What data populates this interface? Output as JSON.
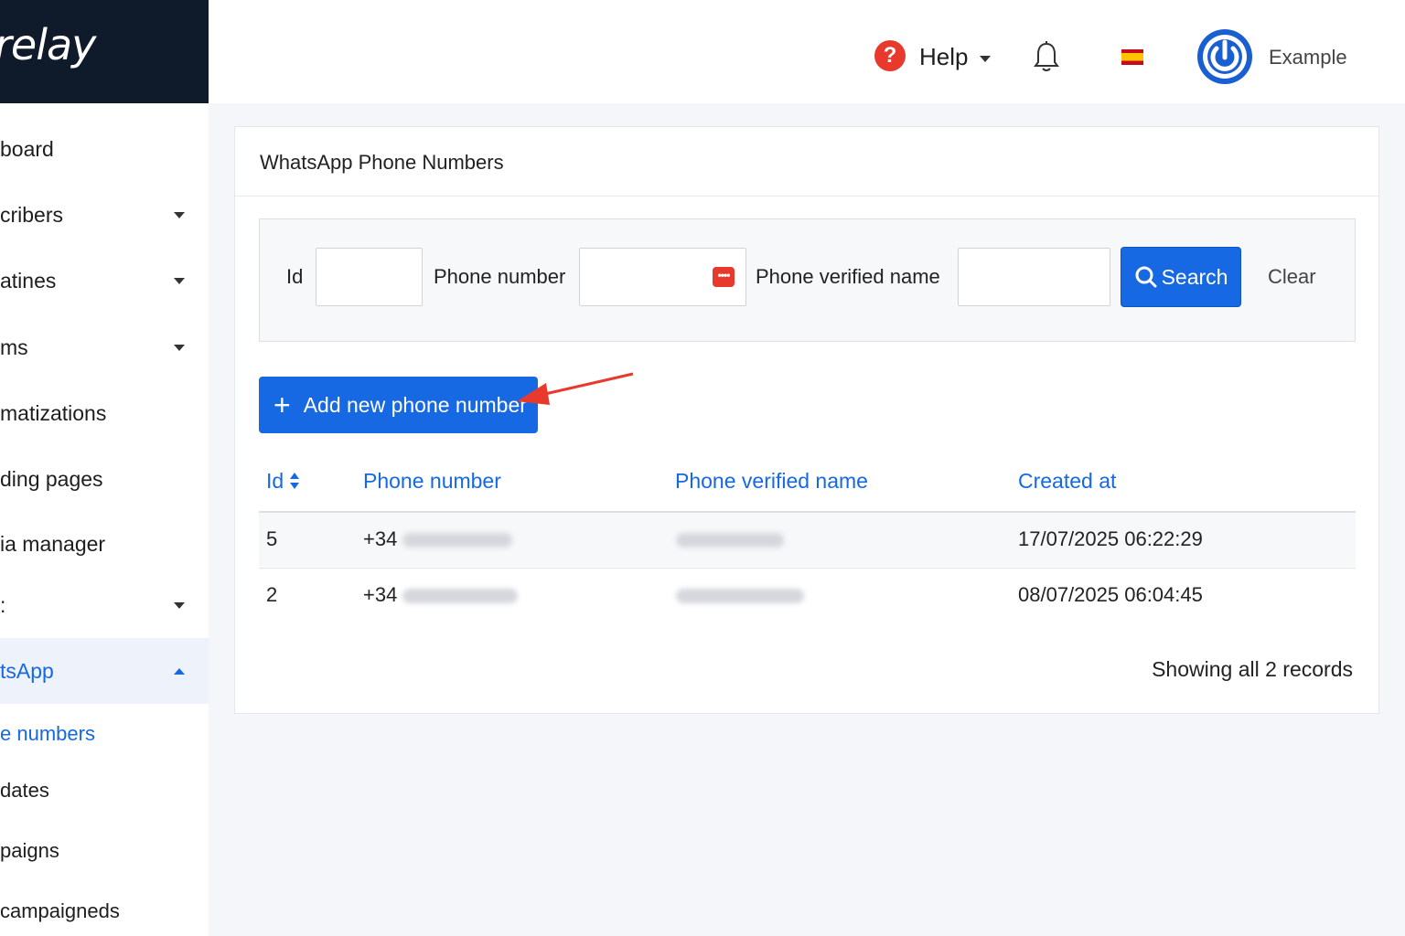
{
  "brand": {
    "logo_text": "relay"
  },
  "sidebar": {
    "items": [
      {
        "label": "board",
        "caret": false
      },
      {
        "label": "cribers",
        "caret": true
      },
      {
        "label": "atines",
        "caret": true
      },
      {
        "label": "ms",
        "caret": true
      },
      {
        "label": " matizations",
        "caret": false
      },
      {
        "label": "ding pages",
        "caret": false
      },
      {
        "label": "ia manager",
        "caret": false
      },
      {
        "label": ":",
        "caret": true
      },
      {
        "label": "tsApp",
        "caret": true,
        "active": true
      }
    ],
    "subitems": [
      {
        "label": "e numbers",
        "current": true
      },
      {
        "label": "dates"
      },
      {
        "label": "paigns"
      },
      {
        "label": " campaigneds"
      }
    ]
  },
  "header": {
    "help_label": "Help",
    "user_name": "Example",
    "icons": [
      "help-icon",
      "bell-icon",
      "spain-flag-icon",
      "power-icon"
    ]
  },
  "card": {
    "title": "WhatsApp Phone Numbers",
    "filter": {
      "id_label": "Id",
      "id_value": "",
      "phone_label": "Phone number",
      "phone_value": "",
      "verified_label": "Phone verified name",
      "verified_value": "",
      "search_label": "Search",
      "clear_label": "Clear"
    },
    "add_button_label": "Add new phone number",
    "table": {
      "headers": [
        "Id",
        "Phone number",
        "Phone verified name",
        "Created at"
      ],
      "rows": [
        {
          "id": "5",
          "phone_prefix": "+34",
          "created_at": "17/07/2025 06:22:29"
        },
        {
          "id": "2",
          "phone_prefix": "+34",
          "created_at": "08/07/2025 06:04:45"
        }
      ]
    },
    "records_text": "Showing all 2 records"
  },
  "colors": {
    "accent": "#1668e3",
    "sidebar_dark": "#0f1a2b",
    "danger": "#e8392d"
  }
}
